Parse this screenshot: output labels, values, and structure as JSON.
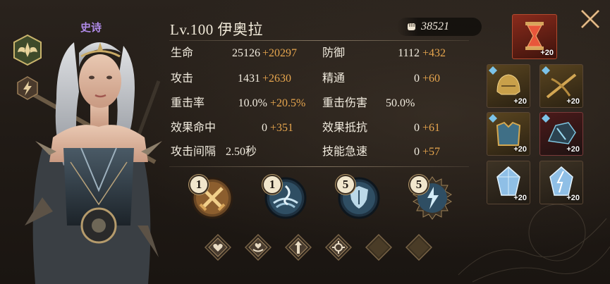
{
  "hero": {
    "rarity": "史诗",
    "level_name": "Lv.100 伊奥拉",
    "power": "38521"
  },
  "stats": {
    "hp": {
      "label": "生命",
      "base": "25126",
      "bonus": "+20297"
    },
    "defense": {
      "label": "防御",
      "base": "1112",
      "bonus": "+432"
    },
    "attack": {
      "label": "攻击",
      "base": "1431",
      "bonus": "+2630"
    },
    "mastery": {
      "label": "精通",
      "base": "0",
      "bonus": "+60"
    },
    "crit_rate": {
      "label": "重击率",
      "base": "10.0%",
      "bonus": "+20.5%"
    },
    "crit_damage": {
      "label": "重击伤害",
      "base": "50.0%",
      "bonus": ""
    },
    "effect_hit": {
      "label": "效果命中",
      "base": "0",
      "bonus": "+351"
    },
    "effect_resist": {
      "label": "效果抵抗",
      "base": "0",
      "bonus": "+61"
    },
    "attack_interval": {
      "label": "攻击间隔",
      "base": "2.50秒",
      "bonus": ""
    },
    "skill_haste": {
      "label": "技能急速",
      "base": "0",
      "bonus": "+57"
    }
  },
  "skills": [
    {
      "level": "1",
      "icon": "crossed-swords-icon"
    },
    {
      "level": "1",
      "icon": "whirlpool-icon"
    },
    {
      "level": "5",
      "icon": "shield-hand-icon"
    },
    {
      "level": "5",
      "icon": "lightning-shard-icon"
    }
  ],
  "runes": [
    {
      "icon": "heart-rune-icon",
      "filled": true
    },
    {
      "icon": "heart-hand-rune-icon",
      "filled": true
    },
    {
      "icon": "arrow-up-rune-icon",
      "filled": true
    },
    {
      "icon": "crosshair-rune-icon",
      "filled": true
    },
    {
      "icon": "empty-rune-slot",
      "filled": false
    },
    {
      "icon": "empty-rune-slot",
      "filled": false
    }
  ],
  "equipment": [
    {
      "slot": "hourglass-relic",
      "plus": "+20"
    },
    {
      "slot": "helmet",
      "plus": "+20"
    },
    {
      "slot": "weapon",
      "plus": "+20"
    },
    {
      "slot": "armor",
      "plus": "+20"
    },
    {
      "slot": "gloves",
      "plus": "+20"
    },
    {
      "slot": "crystal-1",
      "plus": "+20"
    },
    {
      "slot": "crystal-2",
      "plus": "+20"
    }
  ],
  "colors": {
    "accent": "#e7a64e",
    "rarity": "#b08be8",
    "text": "#f2ecdf"
  }
}
